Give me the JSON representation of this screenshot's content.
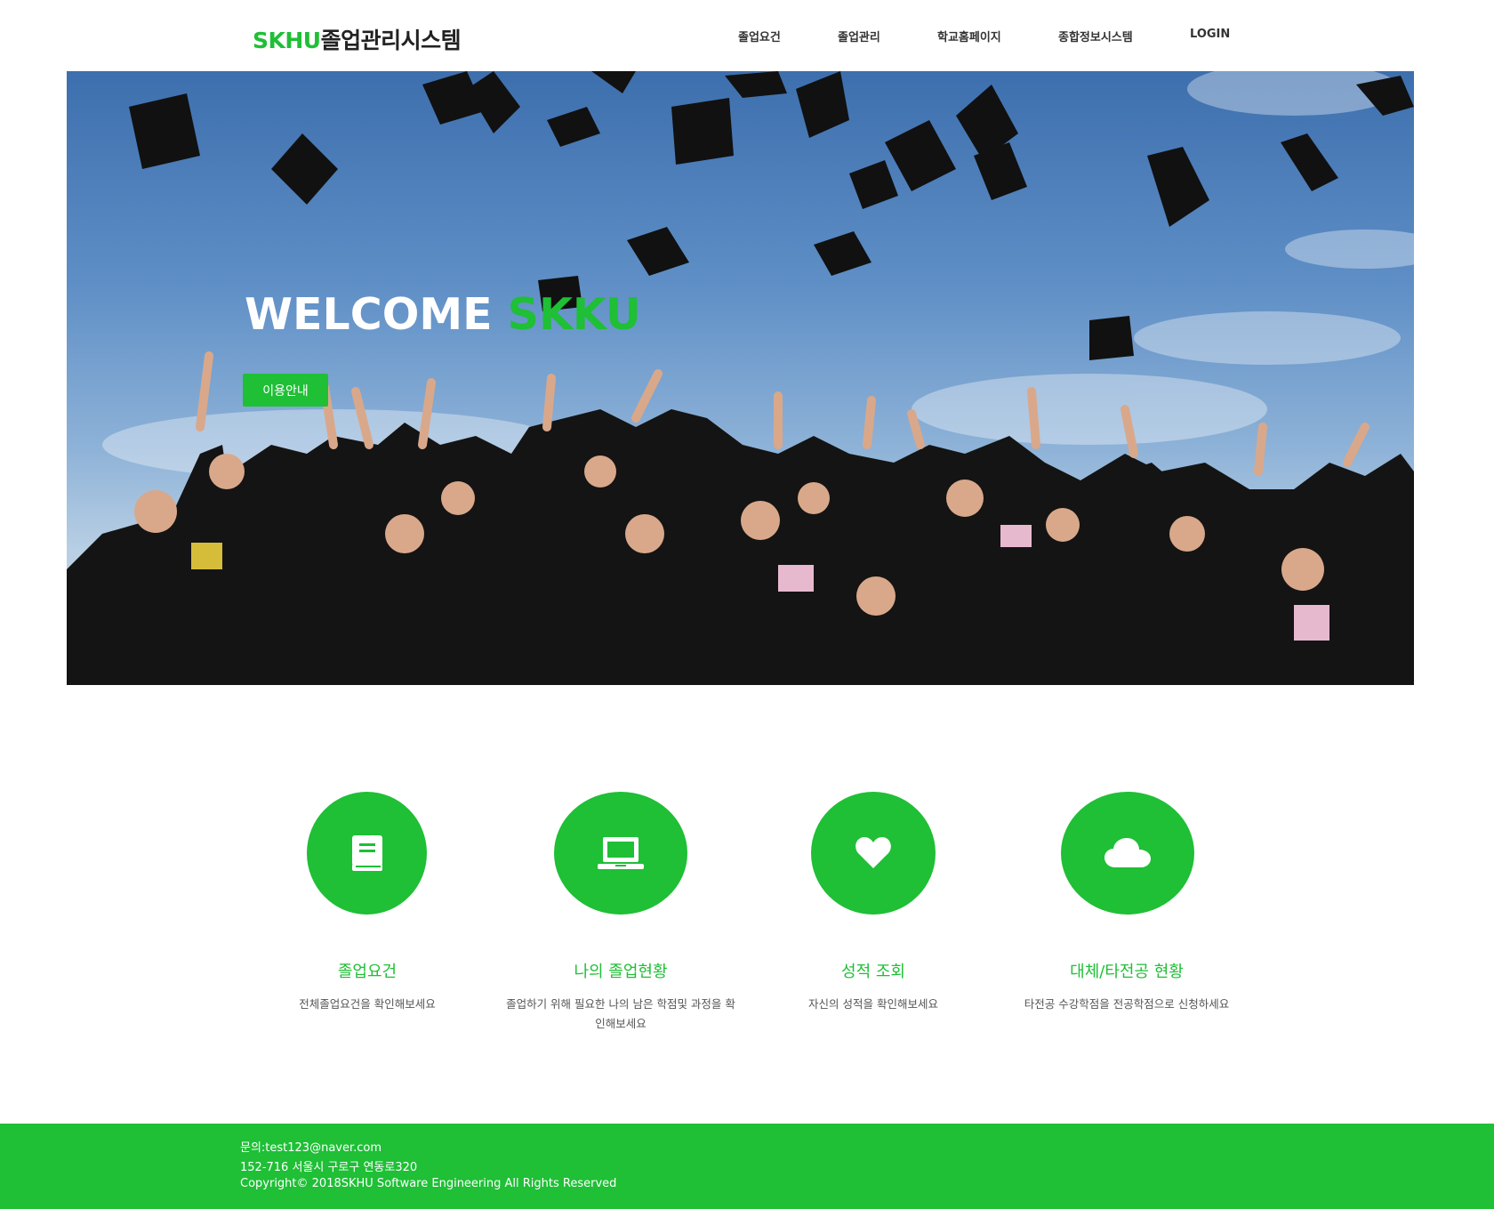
{
  "header": {
    "logo_brand": "SKHU",
    "logo_rest": "졸업관리시스템",
    "nav": [
      "졸업요건",
      "졸업관리",
      "학교홈페이지",
      "종합정보시스템",
      "LOGIN"
    ]
  },
  "hero": {
    "title_white": "WELCOME",
    "title_green": "SKKU",
    "button_label": "이용안내"
  },
  "features": [
    {
      "icon": "book-icon",
      "title": "졸업요건",
      "desc": "전체졸업요건을 확인해보세요"
    },
    {
      "icon": "laptop-icon",
      "title": "나의 졸업현황",
      "desc": "졸업하기 위해 필요한 나의 남은 학점및 과정을 확인해보세요"
    },
    {
      "icon": "heart-icon",
      "title": "성적 조회",
      "desc": "자신의 성적을 확인해보세요"
    },
    {
      "icon": "cloud-icon",
      "title": "대체/타전공 현황",
      "desc": "타전공 수강학점을 전공학점으로 신청하세요"
    }
  ],
  "footer": {
    "contact": "문의:test123@naver.com",
    "address": "152-716 서울시 구로구 연동로320",
    "copyright": "Copyright© 2018SKHU Software Engineering All Rights Reserved"
  },
  "colors": {
    "accent": "#1fbf36",
    "sky": "#5f8fc6",
    "gown": "#151515"
  }
}
